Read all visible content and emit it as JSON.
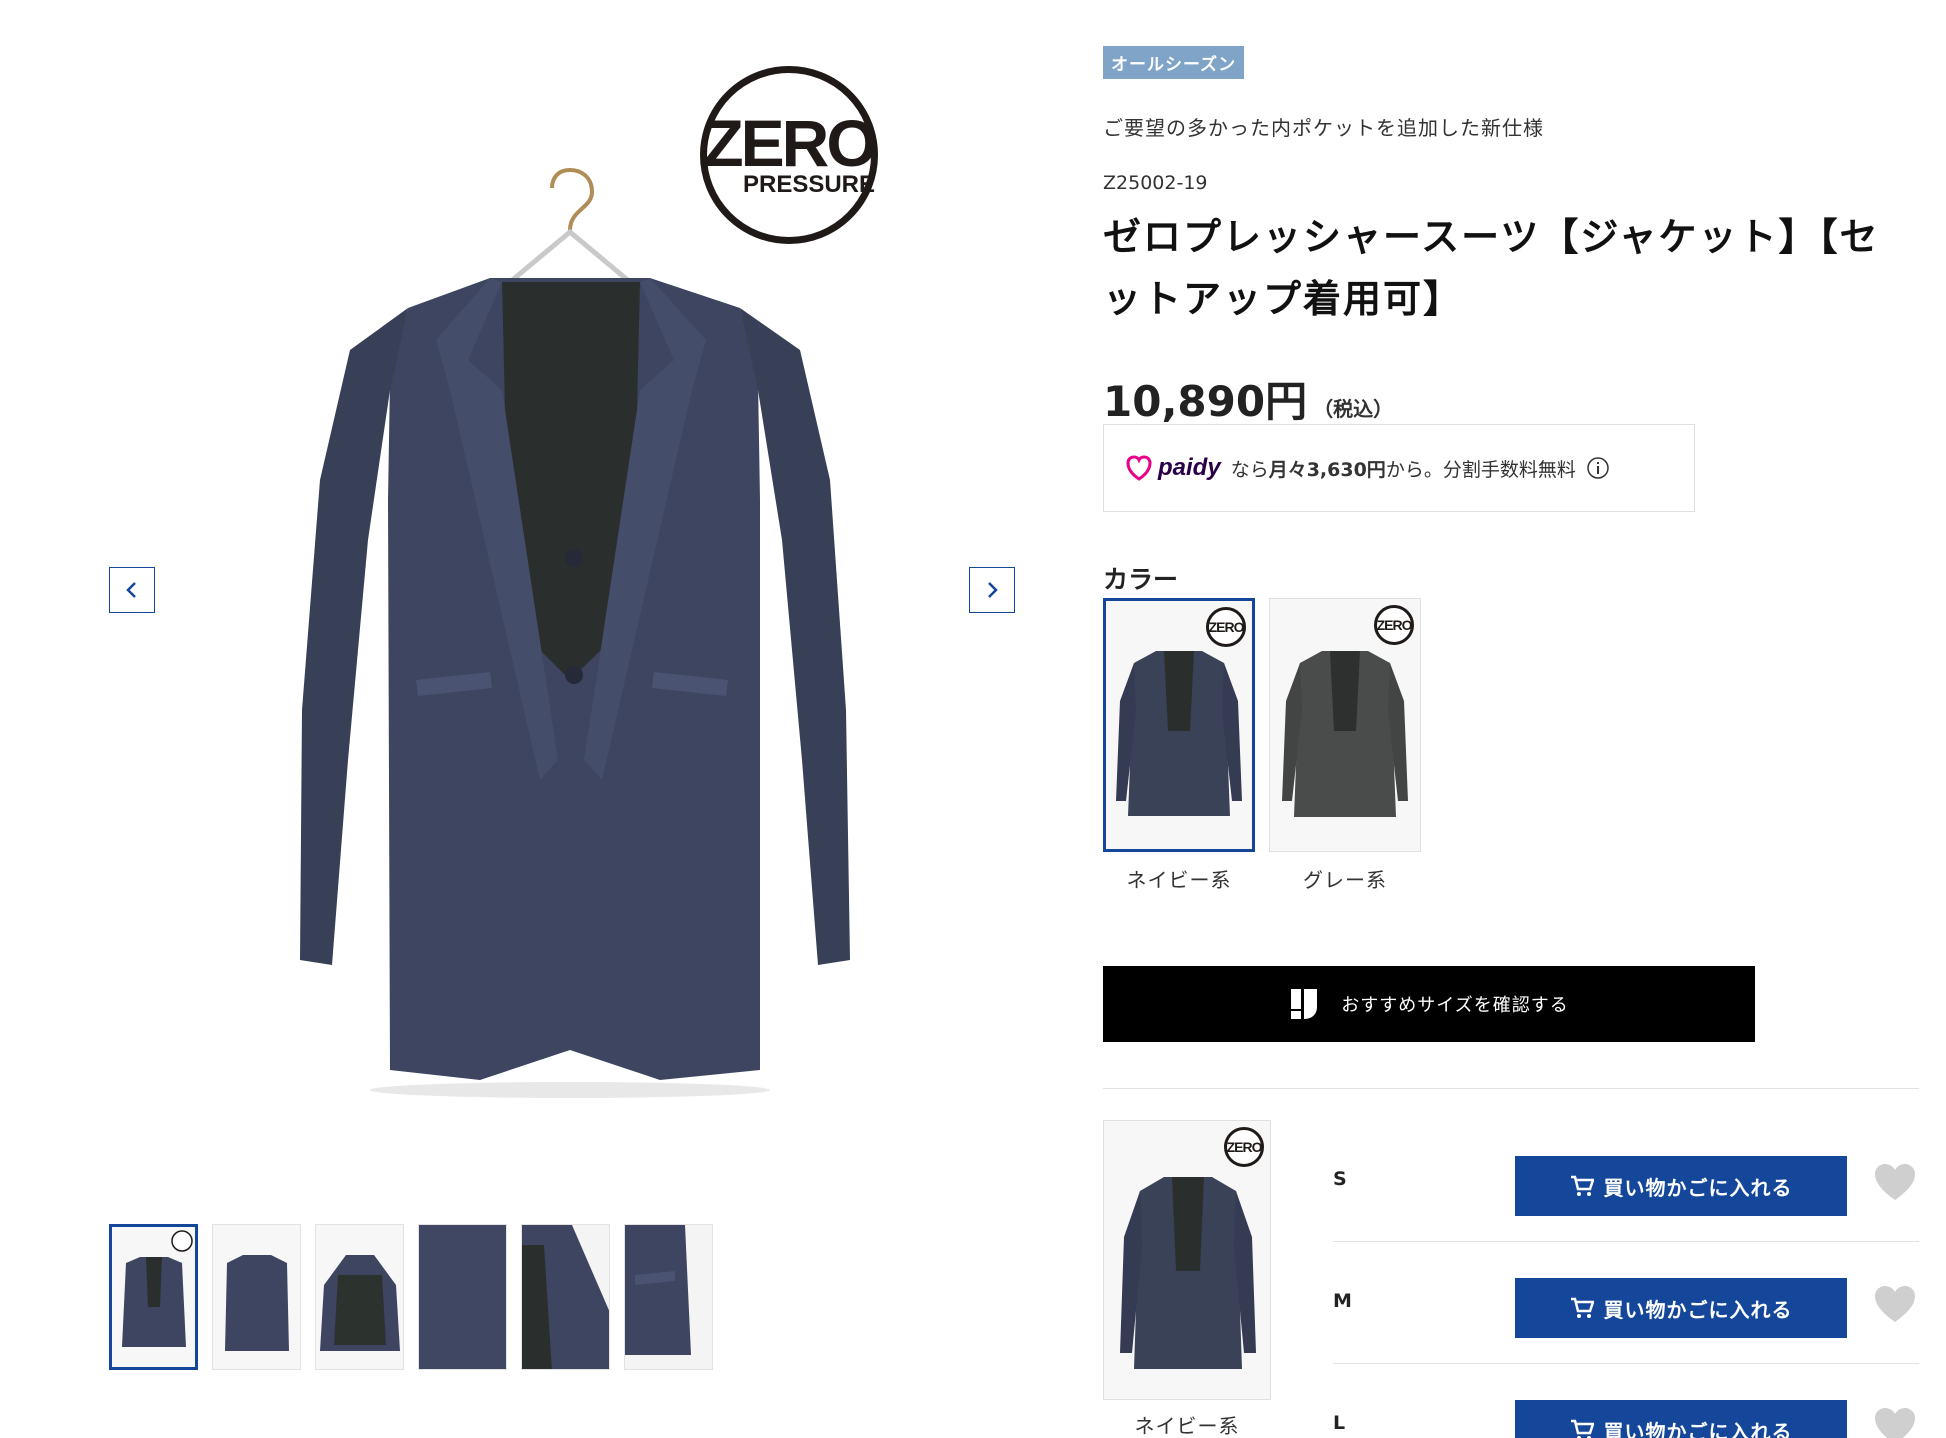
{
  "gallery": {
    "logo_main": "ZERO",
    "logo_sub": "PRESSURE",
    "thumb_count": 6
  },
  "product": {
    "badge": "オールシーズン",
    "catchcopy": "ご要望の多かった内ポケットを追加した新仕様",
    "code": "Z25002-19",
    "title": "ゼロプレッシャースーツ【ジャケット】【セットアップ着用可】",
    "price": "10,890円",
    "tax_label": "（税込）"
  },
  "paidy": {
    "brand": "paidy",
    "text_pre": "なら",
    "monthly": "月々3,630円",
    "text_post": "から。分割手数料無料"
  },
  "color": {
    "label": "カラー",
    "options": [
      {
        "name": "ネイビー系",
        "selected": true,
        "hex": "#3a4258"
      },
      {
        "name": "グレー系",
        "selected": false,
        "hex": "#4a4c4c"
      }
    ]
  },
  "size_advice": {
    "label": "おすすめサイズを確認する"
  },
  "stock": {
    "color_name": "ネイビー系",
    "sizes": [
      {
        "size": "S",
        "button": "買い物かごに入れる"
      },
      {
        "size": "M",
        "button": "買い物かごに入れる"
      },
      {
        "size": "L",
        "button": "買い物かごに入れる"
      }
    ]
  },
  "colors": {
    "accent": "#14479a",
    "badge": "#7fa4c8",
    "jacket_navy": "#3a4258"
  }
}
